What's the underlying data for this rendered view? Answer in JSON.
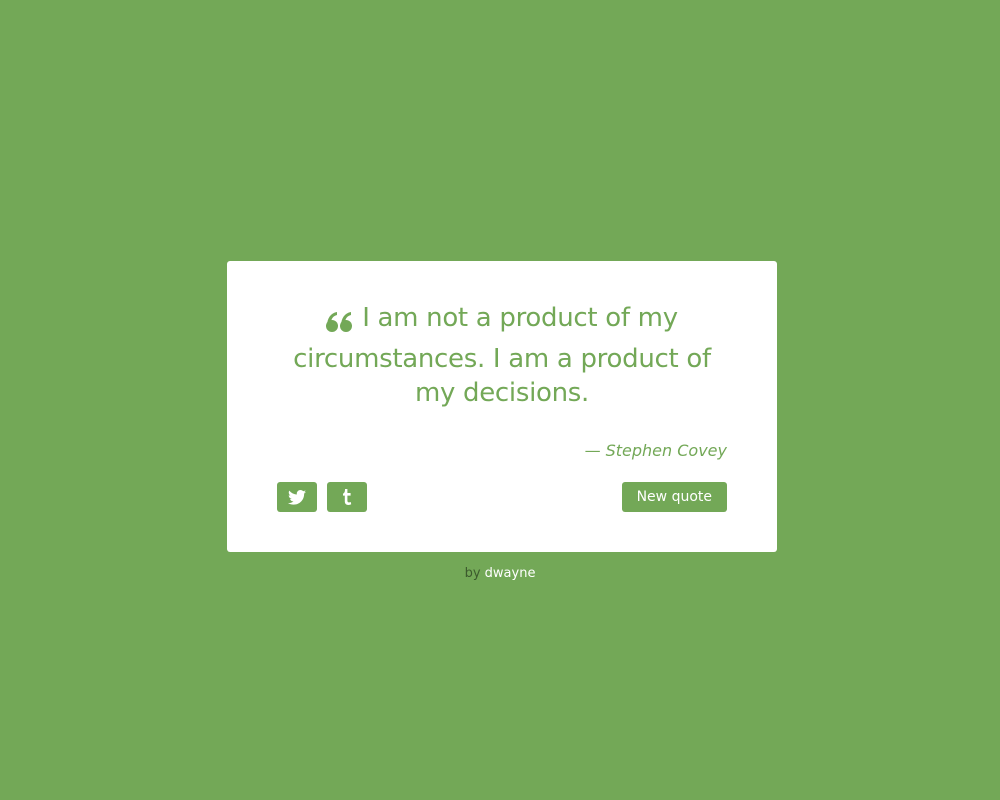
{
  "colors": {
    "background": "#73a857",
    "card": "#ffffff",
    "accent": "#73a857",
    "footer_text": "#3c5a2d",
    "footer_link": "#ffffff"
  },
  "quote": {
    "icon": "quote-left-icon",
    "text": "I am not a product of my circumstances. I am a product of my decisions.",
    "author_dash": "—",
    "author": "Stephen Covey"
  },
  "buttons": {
    "twitter_icon": "twitter-icon",
    "tumblr_icon": "tumblr-icon",
    "new_quote_label": "New quote"
  },
  "footer": {
    "prefix": "by",
    "author": "dwayne"
  }
}
